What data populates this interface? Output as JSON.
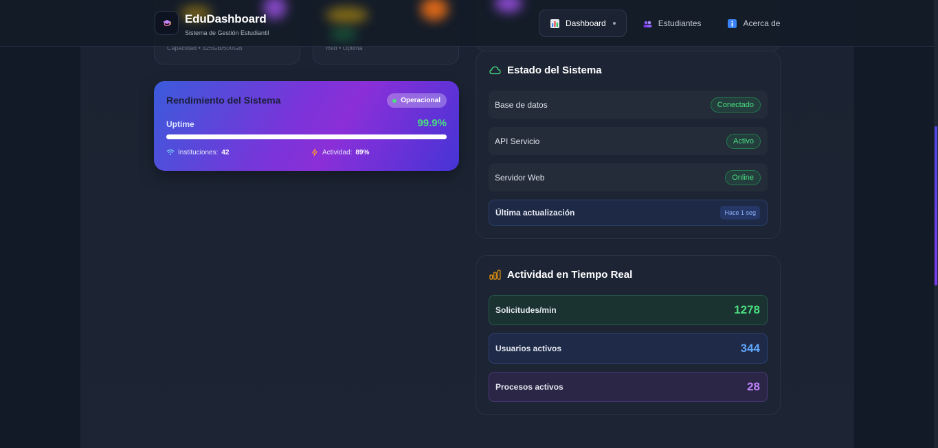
{
  "app": {
    "title": "EduDashboard",
    "subtitle": "Sistema de Gestión Estudiantil"
  },
  "nav": {
    "items": [
      {
        "label": "Dashboard",
        "icon": "dashboard-icon",
        "active": true
      },
      {
        "label": "Estudiantes",
        "icon": "students-icon",
        "active": false
      },
      {
        "label": "Acerca de",
        "icon": "info-icon",
        "active": false
      }
    ]
  },
  "top_cards": {
    "storage_caption": "Capacidad • 325GB/500GB",
    "network_caption": "Red • Óptima"
  },
  "performance": {
    "title": "Rendimiento del Sistema",
    "badge": "Operacional",
    "uptime_label": "Uptime",
    "uptime_value": "99.9%",
    "uptime_fraction": 0.999,
    "institutions_label": "Instituciones:",
    "institutions_value": "42",
    "activity_label": "Actividad:",
    "activity_value": "89%"
  },
  "system_status": {
    "title": "Estado del Sistema",
    "rows": [
      {
        "name": "Base de datos",
        "status": "Conectado"
      },
      {
        "name": "API Servicio",
        "status": "Activo"
      },
      {
        "name": "Servidor Web",
        "status": "Online"
      }
    ],
    "last_update_label": "Última actualización",
    "last_update_value": "Hace 1 seg"
  },
  "realtime": {
    "title": "Actividad en Tiempo Real",
    "metrics": [
      {
        "name": "Solicitudes/min",
        "value": "1278",
        "color": "#4ade80"
      },
      {
        "name": "Usuarios activos",
        "value": "344",
        "color": "#60a5fa"
      },
      {
        "name": "Procesos activos",
        "value": "28",
        "color": "#c084fc"
      }
    ]
  },
  "colors": {
    "accent_green": "#4ade80",
    "accent_blue": "#60a5fa",
    "accent_purple": "#c084fc",
    "background": "#131a27"
  }
}
